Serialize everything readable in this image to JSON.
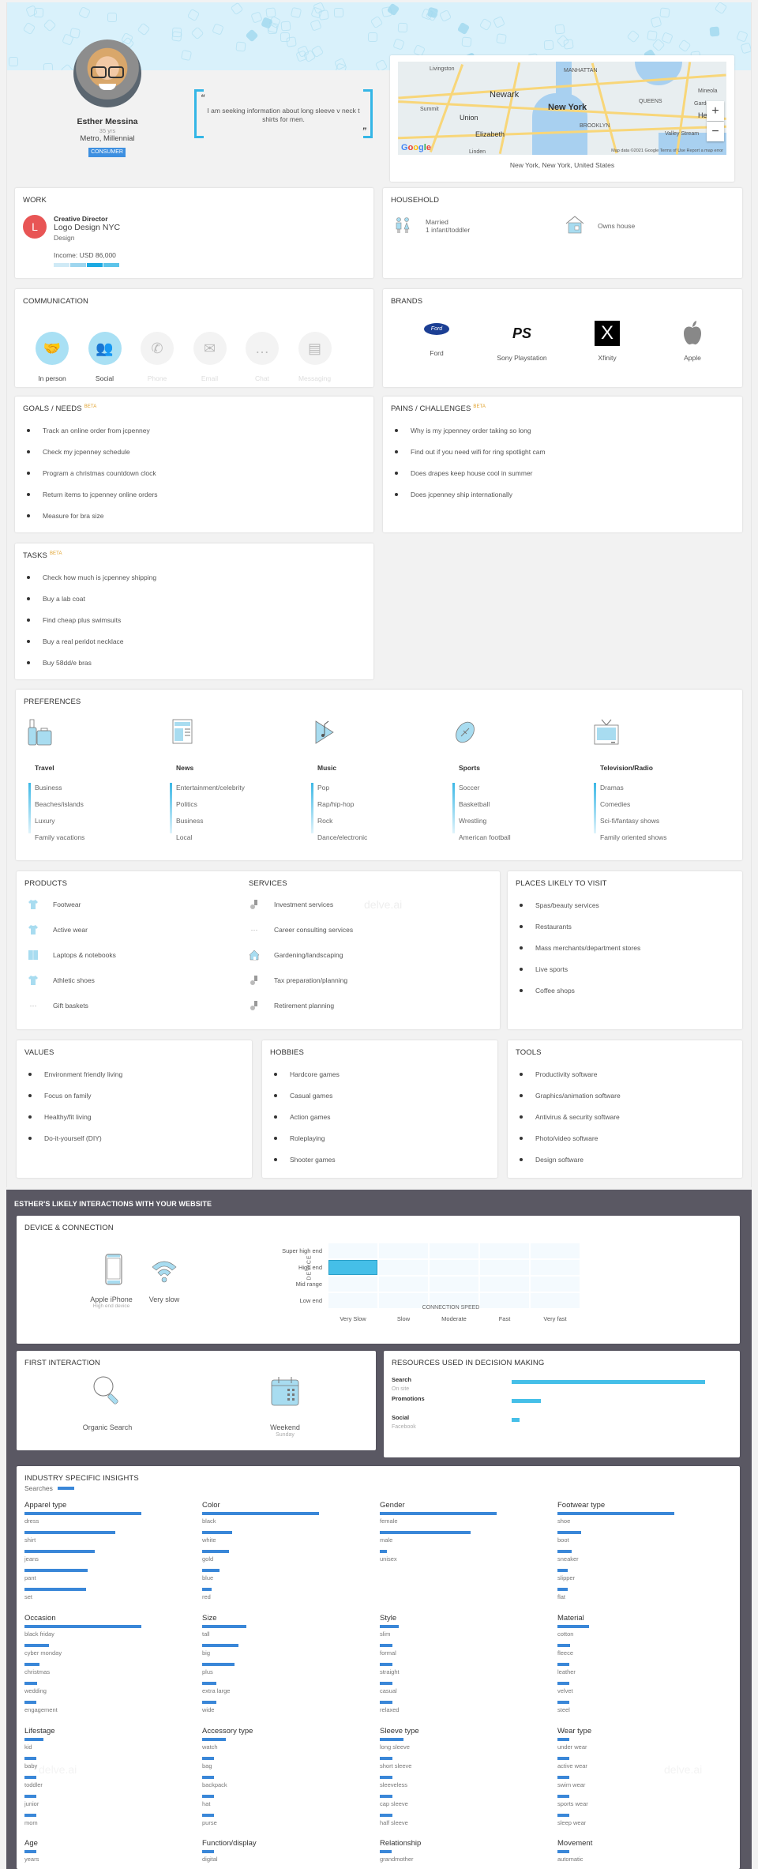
{
  "profile": {
    "name": "Esther Messina",
    "age": "35 yrs",
    "segment": "Metro, Millennial",
    "badge": "CONSUMER",
    "quote": "I am seeking information about long sleeve v neck t shirts for men."
  },
  "map": {
    "location": "New York, New York, United States",
    "labels": [
      "Livingston",
      "MANHATTAN",
      "Newark",
      "New York",
      "QUEENS",
      "Summit",
      "Union",
      "BROOKLYN",
      "Elizabeth",
      "Mineola",
      "Garden",
      "Hem",
      "Valley Stream",
      "Linden"
    ],
    "zoom_in": "+",
    "zoom_out": "−",
    "google": "Google",
    "footer": "Map data ©2021 Google   Terms of Use   Report a map error"
  },
  "work": {
    "title": "WORK",
    "logo_letter": "L",
    "role": "Creative Director",
    "company": "Logo Design NYC",
    "industry": "Design",
    "income": "Income: USD 86,000",
    "income_level": 3,
    "income_levels_total": 4
  },
  "household": {
    "title": "HOUSEHOLD",
    "status": "Married",
    "kids": "1 infant/toddler",
    "home": "Owns house"
  },
  "communication": {
    "title": "COMMUNICATION",
    "channels": [
      {
        "label": "In person",
        "active": true,
        "icon": "handshake-icon"
      },
      {
        "label": "Social",
        "active": true,
        "icon": "people-icon"
      },
      {
        "label": "Phone",
        "active": false,
        "icon": "phone-icon"
      },
      {
        "label": "Email",
        "active": false,
        "icon": "envelope-icon"
      },
      {
        "label": "Chat",
        "active": false,
        "icon": "chat-bubble-icon"
      },
      {
        "label": "Messaging",
        "active": false,
        "icon": "message-icon"
      }
    ]
  },
  "brands": {
    "title": "BRANDS",
    "items": [
      {
        "label": "Ford",
        "logo": "Ford"
      },
      {
        "label": "Sony Playstation",
        "logo": "PS"
      },
      {
        "label": "Xfinity",
        "logo": "X"
      },
      {
        "label": "Apple",
        "logo": ""
      }
    ]
  },
  "goals": {
    "title": "GOALS / NEEDS",
    "beta": "BETA",
    "items": [
      "Track an online order from jcpenney",
      "Check my jcpenney schedule",
      "Program a christmas countdown clock",
      "Return items to jcpenney online orders",
      "Measure for bra size"
    ]
  },
  "pains": {
    "title": "PAINS / CHALLENGES",
    "beta": "BETA",
    "items": [
      "Why is my jcpenney order taking so long",
      "Find out if you need wifi for ring spotlight cam",
      "Does drapes keep house cool in summer",
      "Does jcpenney ship internationally"
    ]
  },
  "tasks": {
    "title": "TASKS",
    "beta": "BETA",
    "items": [
      "Check how much is jcpenney shipping",
      "Buy a lab coat",
      "Find cheap plus swimsuits",
      "Buy a real peridot necklace",
      "Buy 58dd/e bras"
    ]
  },
  "preferences": {
    "title": "PREFERENCES",
    "columns": [
      {
        "heading": "Travel",
        "items": [
          "Business",
          "Beaches/islands",
          "Luxury",
          "Family vacations"
        ]
      },
      {
        "heading": "News",
        "items": [
          "Entertainment/celebrity",
          "Politics",
          "Business",
          "Local"
        ]
      },
      {
        "heading": "Music",
        "items": [
          "Pop",
          "Rap/hip-hop",
          "Rock",
          "Dance/electronic"
        ]
      },
      {
        "heading": "Sports",
        "items": [
          "Soccer",
          "Basketball",
          "Wrestling",
          "American football"
        ]
      },
      {
        "heading": "Television/Radio",
        "items": [
          "Dramas",
          "Comedies",
          "Sci-fi/fantasy shows",
          "Family oriented shows"
        ]
      }
    ]
  },
  "products": {
    "title": "PRODUCTS",
    "items": [
      "Footwear",
      "Active wear",
      "Laptops & notebooks",
      "Athletic shoes",
      "Gift baskets"
    ]
  },
  "services": {
    "title": "SERVICES",
    "items": [
      "Investment services",
      "Career consulting services",
      "Gardening/landscaping",
      "Tax preparation/planning",
      "Retirement planning"
    ]
  },
  "places": {
    "title": "PLACES LIKELY TO VISIT",
    "items": [
      "Spas/beauty services",
      "Restaurants",
      "Mass merchants/department stores",
      "Live sports",
      "Coffee shops"
    ]
  },
  "values": {
    "title": "VALUES",
    "items": [
      "Environment friendly living",
      "Focus on family",
      "Healthy/fit living",
      "Do-it-yourself (DIY)"
    ]
  },
  "hobbies": {
    "title": "HOBBIES",
    "items": [
      "Hardcore games",
      "Casual games",
      "Action games",
      "Roleplaying",
      "Shooter games"
    ]
  },
  "tools": {
    "title": "TOOLS",
    "items": [
      "Productivity software",
      "Graphics/animation software",
      "Antivirus & security software",
      "Photo/video software",
      "Design software"
    ]
  },
  "watermark": "delve.ai",
  "interactions": {
    "title": "ESTHER'S LIKELY INTERACTIONS WITH YOUR WEBSITE",
    "device": {
      "title": "DEVICE & CONNECTION",
      "device_name": "Apple iPhone",
      "device_sub": "High end device",
      "connection": "Very slow",
      "y_axis_label": "DEVICE",
      "x_axis_label": "CONNECTION SPEED",
      "rows": [
        "Super high end",
        "High end",
        "Mid range",
        "Low end"
      ],
      "cols": [
        "Very Slow",
        "Slow",
        "Moderate",
        "Fast",
        "Very fast"
      ],
      "highlight": {
        "row": "High end",
        "col": "Very Slow"
      }
    },
    "first": {
      "title": "FIRST INTERACTION",
      "channel": "Organic Search",
      "day": "Weekend",
      "day_sub": "Sunday"
    },
    "resources": {
      "title": "RESOURCES USED IN DECISION MAKING",
      "items": [
        {
          "name": "Search",
          "sub": "On site",
          "value": 100
        },
        {
          "name": "Promotions",
          "sub": "",
          "value": 15
        },
        {
          "name": "Social",
          "sub": "Facebook",
          "value": 4
        }
      ]
    }
  },
  "chart_data": {
    "type": "bar",
    "title": "INDUSTRY SPECIFIC INSIGHTS",
    "legend": [
      {
        "name": "Searches",
        "color": "#3a87d8"
      }
    ],
    "groups": [
      {
        "name": "Apparel type",
        "categories": [
          "dress",
          "shirt",
          "jeans",
          "pant",
          "set"
        ],
        "values": [
          100,
          78,
          60,
          54,
          53
        ]
      },
      {
        "name": "Color",
        "categories": [
          "black",
          "white",
          "gold",
          "blue",
          "red"
        ],
        "values": [
          100,
          26,
          23,
          15,
          8
        ]
      },
      {
        "name": "Gender",
        "categories": [
          "female",
          "male",
          "unisex"
        ],
        "values": [
          100,
          78,
          6
        ]
      },
      {
        "name": "Footwear type",
        "categories": [
          "shoe",
          "boot",
          "sneaker",
          "slipper",
          "flat"
        ],
        "values": [
          100,
          20,
          12,
          9,
          9
        ]
      },
      {
        "name": "Occasion",
        "categories": [
          "black friday",
          "cyber monday",
          "christmas",
          "wedding",
          "engagement"
        ],
        "values": [
          100,
          21,
          13,
          11,
          10
        ]
      },
      {
        "name": "Size",
        "categories": [
          "tall",
          "big",
          "plus",
          "extra large",
          "wide"
        ],
        "values": [
          38,
          31,
          28,
          12,
          12
        ]
      },
      {
        "name": "Style",
        "categories": [
          "slim",
          "formal",
          "straight",
          "casual",
          "relaxed"
        ],
        "values": [
          16,
          11,
          11,
          11,
          11
        ]
      },
      {
        "name": "Material",
        "categories": [
          "cotton",
          "fleece",
          "leather",
          "velvet",
          "steel"
        ],
        "values": [
          27,
          11,
          10,
          10,
          10
        ]
      },
      {
        "name": "Lifestage",
        "categories": [
          "kid",
          "baby",
          "toddler",
          "junior",
          "mom"
        ],
        "values": [
          16,
          10,
          10,
          10,
          10
        ]
      },
      {
        "name": "Accessory type",
        "categories": [
          "watch",
          "bag",
          "backpack",
          "hat",
          "purse"
        ],
        "values": [
          20,
          10,
          10,
          10,
          10
        ]
      },
      {
        "name": "Sleeve type",
        "categories": [
          "long sleeve",
          "short sleeve",
          "sleeveless",
          "cap sleeve",
          "half sleeve"
        ],
        "values": [
          20,
          11,
          11,
          11,
          11
        ]
      },
      {
        "name": "Wear type",
        "categories": [
          "under wear",
          "active wear",
          "swim wear",
          "sports wear",
          "sleep wear"
        ],
        "values": [
          10,
          10,
          10,
          10,
          10
        ]
      },
      {
        "name": "Age",
        "categories": [
          "years"
        ],
        "values": [
          10
        ]
      },
      {
        "name": "Function/display",
        "categories": [
          "digital"
        ],
        "values": [
          10
        ]
      },
      {
        "name": "Relationship",
        "categories": [
          "grandmother"
        ],
        "values": [
          10
        ]
      },
      {
        "name": "Movement",
        "categories": [
          "automatic"
        ],
        "values": [
          10
        ]
      }
    ]
  }
}
